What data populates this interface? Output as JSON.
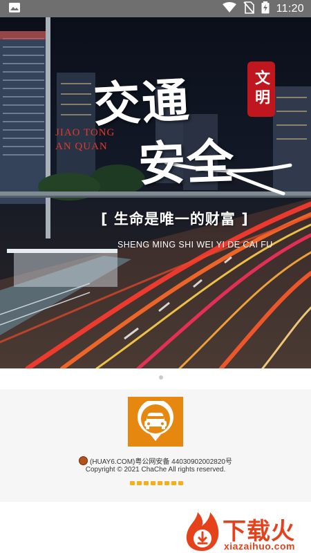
{
  "status_bar": {
    "time": "11:20",
    "icons": [
      "image-icon",
      "wifi-icon",
      "no-sim-icon",
      "battery-charging-icon"
    ]
  },
  "banner": {
    "title_line1": "交通",
    "title_line2": "安全",
    "seal_text": "文明",
    "pinyin_text": "JIAO TONG AN QUAN",
    "slogan": "[ 生命是唯一的财富 ]",
    "slogan_pinyin": "SHENG MING SHI WEI YI DE CAI FU"
  },
  "pager": {
    "current": 1,
    "total": 1
  },
  "footer": {
    "logo_icon": "car-location-icon",
    "logo_color": "#e6870f",
    "icp_text": "(HUAY6.COM)粤公网安备 44030902002820号",
    "copyright": "Copyright © 2021 ChaChe All rights reserved."
  },
  "watermark": {
    "brand": "下载火",
    "url": "xiazaihuo.com",
    "color": "#e5421c"
  }
}
